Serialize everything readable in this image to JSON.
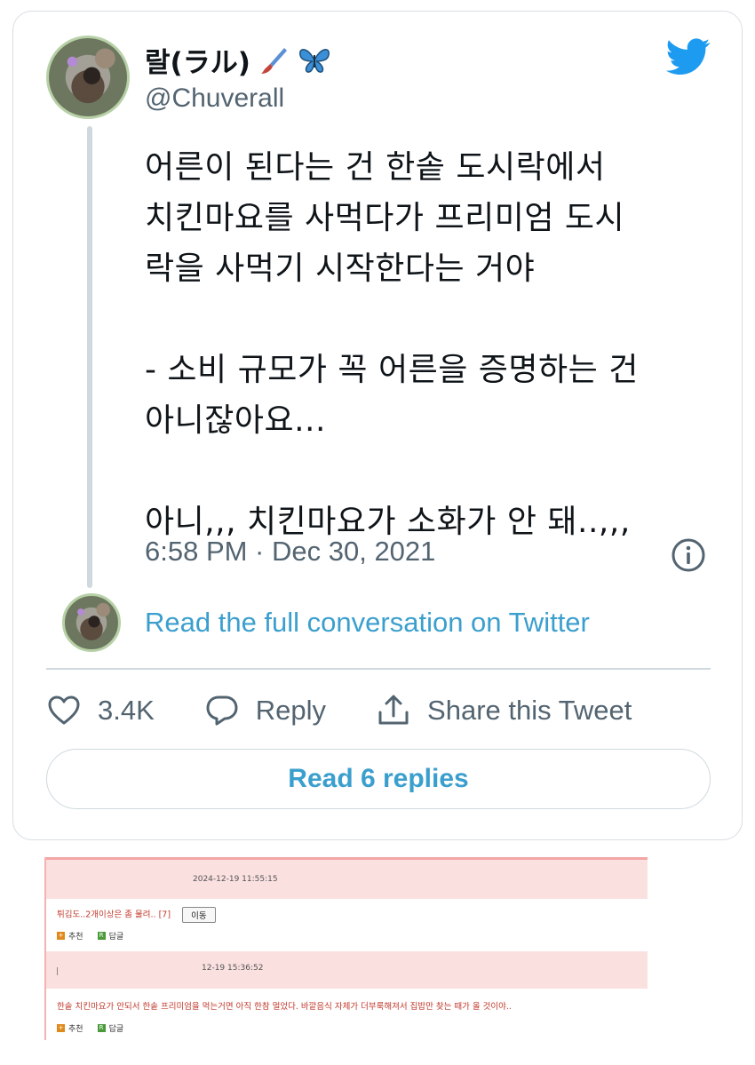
{
  "tweet": {
    "display_name": "랄(ラル)",
    "handle": "@Chuverall",
    "text": "어른이 된다는 건 한솥 도시락에서\n치킨마요를 사먹다가 프리미엄 도시\n락을 사먹기 시작한다는 거야\n\n- 소비 규모가 꼭 어른을 증명하는 건\n아니잖아요...\n\n아니,,, 치킨마요가 소화가 안 돼..,,,",
    "timestamp": "6:58 PM · Dec 30, 2021",
    "read_full": "Read the full conversation on Twitter",
    "likes": "3.4K",
    "reply_label": "Reply",
    "share_label": "Share this Tweet",
    "read_replies": "Read 6 replies",
    "icons": [
      "brush-icon",
      "butterfly-icon",
      "twitter-bird-icon",
      "info-icon",
      "heart-icon",
      "reply-icon",
      "share-icon"
    ],
    "accent_color": "#1d9bf0"
  },
  "comments": [
    {
      "date": "2024-12-19 11:55:15",
      "text": "튀김도..2개이상은 좀 물려.. [7]",
      "move_label": "이동",
      "recommend_label": "추천",
      "reply_label": "답글"
    },
    {
      "date": "12-19 15:36:52",
      "text": "한솥 치킨마요가 안되서 한솥 프리미엄을 먹는거면 아직 한참 멀었다. 바깥음식 자체가 더부룩해져서 집밥만 찾는 때가 올 것이야..",
      "recommend_label": "추천",
      "reply_label": "답글"
    }
  ]
}
